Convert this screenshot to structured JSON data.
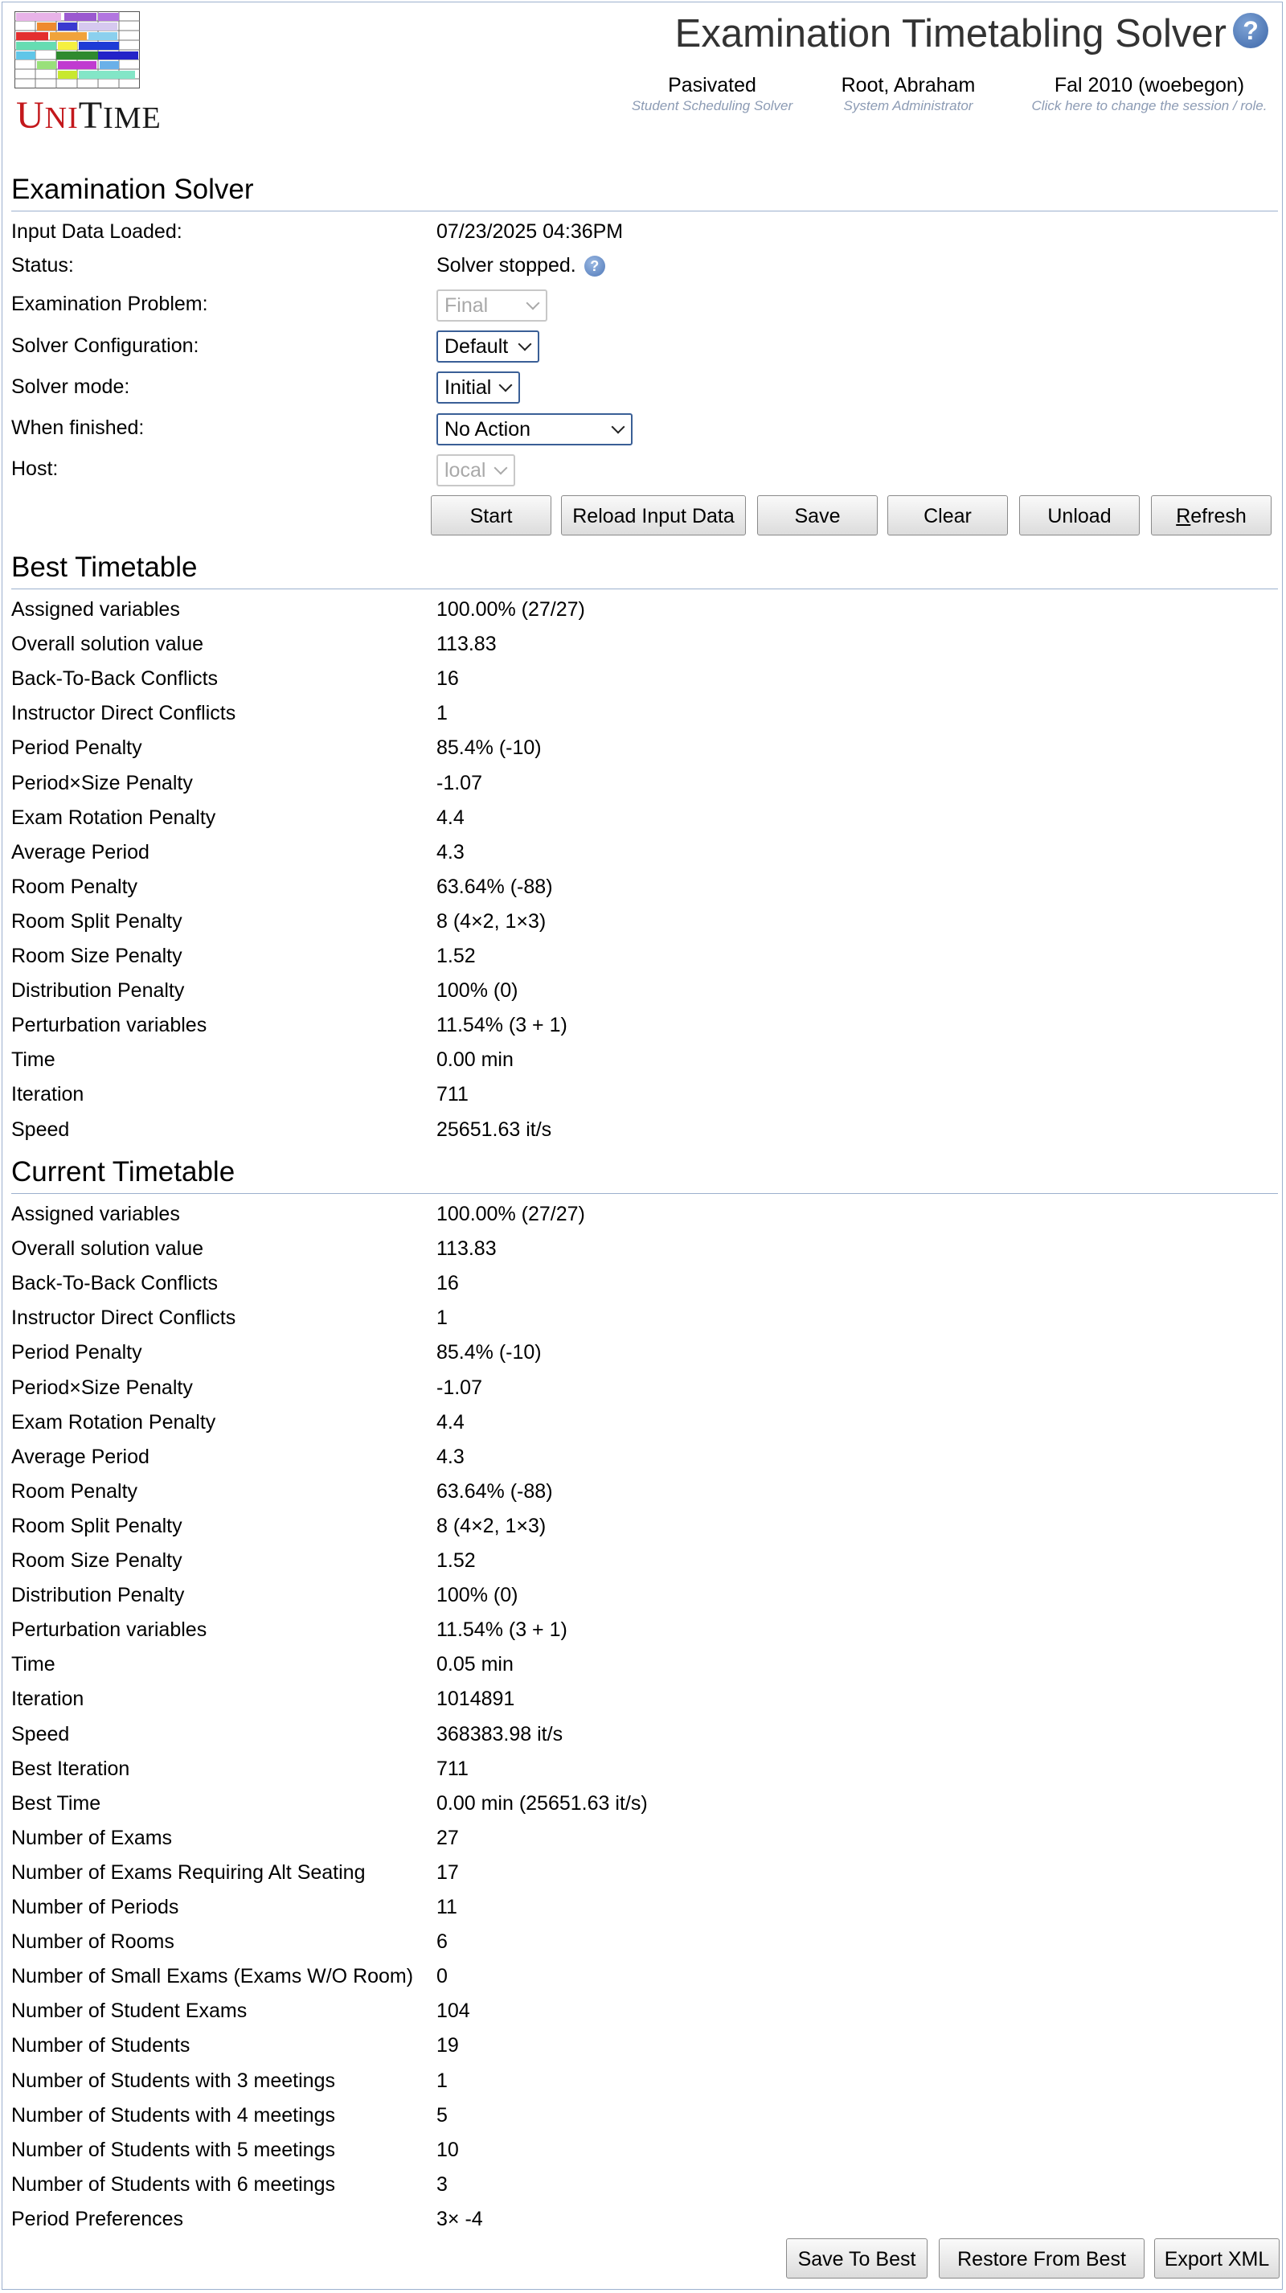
{
  "header": {
    "logo": {
      "brand_first": "U",
      "brand_mid": "NI",
      "brand_last": "T",
      "brand_tail": "IME"
    },
    "title": "Examination Timetabling Solver",
    "info": [
      {
        "main": "Pasivated",
        "sub": "Student Scheduling Solver"
      },
      {
        "main": "Root, Abraham",
        "sub": "System Administrator"
      },
      {
        "main": "Fal 2010 (woebegon)",
        "sub": "Click here to change the session / role."
      }
    ],
    "help_icon": "help-icon"
  },
  "solver": {
    "title": "Examination Solver",
    "input_loaded_label": "Input Data Loaded:",
    "input_loaded_value": "07/23/2025 04:36PM",
    "status_label": "Status:",
    "status_value": "Solver stopped.",
    "problem_label": "Examination Problem:",
    "problem_value": "Final",
    "config_label": "Solver Configuration:",
    "config_value": "Default",
    "mode_label": "Solver mode:",
    "mode_value": "Initial",
    "finished_label": "When finished:",
    "finished_value": "No Action",
    "host_label": "Host:",
    "host_value": "local",
    "buttons": {
      "start": "Start",
      "reload": "Reload Input Data",
      "save": "Save",
      "clear": "Clear",
      "unload": "Unload",
      "refresh_first": "R",
      "refresh_rest": "efresh"
    }
  },
  "best": {
    "title": "Best Timetable",
    "rows": [
      [
        "Assigned variables",
        "100.00% (27/27)"
      ],
      [
        "Overall solution value",
        "113.83"
      ],
      [
        "Back-To-Back Conflicts",
        "16"
      ],
      [
        "Instructor Direct Conflicts",
        "1"
      ],
      [
        "Period Penalty",
        "85.4% (-10)"
      ],
      [
        "Period×Size Penalty",
        "-1.07"
      ],
      [
        "Exam Rotation Penalty",
        "4.4"
      ],
      [
        "Average Period",
        "4.3"
      ],
      [
        "Room Penalty",
        "63.64% (-88)"
      ],
      [
        "Room Split Penalty",
        "8 (4×2, 1×3)"
      ],
      [
        "Room Size Penalty",
        "1.52"
      ],
      [
        "Distribution Penalty",
        "100% (0)"
      ],
      [
        "Perturbation variables",
        "11.54% (3 + 1)"
      ],
      [
        "Time",
        "0.00 min"
      ],
      [
        "Iteration",
        "711"
      ],
      [
        "Speed",
        "25651.63 it/s"
      ]
    ]
  },
  "current": {
    "title": "Current Timetable",
    "rows": [
      [
        "Assigned variables",
        "100.00% (27/27)"
      ],
      [
        "Overall solution value",
        "113.83"
      ],
      [
        "Back-To-Back Conflicts",
        "16"
      ],
      [
        "Instructor Direct Conflicts",
        "1"
      ],
      [
        "Period Penalty",
        "85.4% (-10)"
      ],
      [
        "Period×Size Penalty",
        "-1.07"
      ],
      [
        "Exam Rotation Penalty",
        "4.4"
      ],
      [
        "Average Period",
        "4.3"
      ],
      [
        "Room Penalty",
        "63.64% (-88)"
      ],
      [
        "Room Split Penalty",
        "8 (4×2, 1×3)"
      ],
      [
        "Room Size Penalty",
        "1.52"
      ],
      [
        "Distribution Penalty",
        "100% (0)"
      ],
      [
        "Perturbation variables",
        "11.54% (3 + 1)"
      ],
      [
        "Time",
        "0.05 min"
      ],
      [
        "Iteration",
        "1014891"
      ],
      [
        "Speed",
        "368383.98 it/s"
      ],
      [
        "Best Iteration",
        "711"
      ],
      [
        "Best Time",
        "0.00 min (25651.63 it/s)"
      ],
      [
        "Number of Exams",
        "27"
      ],
      [
        "Number of Exams Requiring Alt Seating",
        "17"
      ],
      [
        "Number of Periods",
        "11"
      ],
      [
        "Number of Rooms",
        "6"
      ],
      [
        "Number of Small Exams (Exams W/O Room)",
        "0"
      ],
      [
        "Number of Student Exams",
        "104"
      ],
      [
        "Number of Students",
        "19"
      ],
      [
        "Number of Students with 3 meetings",
        "1"
      ],
      [
        "Number of Students with 4 meetings",
        "5"
      ],
      [
        "Number of Students with 5 meetings",
        "10"
      ],
      [
        "Number of Students with 6 meetings",
        "3"
      ],
      [
        "Period Preferences",
        "3× -4"
      ]
    ],
    "buttons": {
      "save_to_best": "Save To Best",
      "restore_from_best": "Restore From Best",
      "export_xml": "Export XML"
    }
  }
}
